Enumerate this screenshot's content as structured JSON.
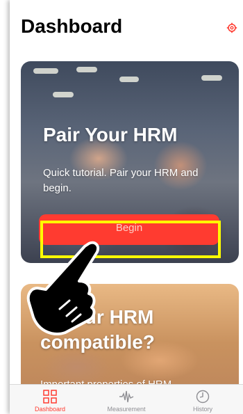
{
  "header": {
    "title": "Dashboard",
    "settings_icon": "settings-gear-icon"
  },
  "cards": [
    {
      "title": "Pair Your HRM",
      "description": "Quick tutorial. Pair your HRM and begin.",
      "button_label": "Begin"
    },
    {
      "title": "Is your HRM compatible?",
      "description": "Important properties of HRM"
    }
  ],
  "tab_bar": {
    "tabs": [
      {
        "label": "Dashboard",
        "icon": "grid-icon",
        "active": true
      },
      {
        "label": "Measurement",
        "icon": "waveform-icon",
        "active": false
      },
      {
        "label": "History",
        "icon": "clock-icon",
        "active": false
      }
    ]
  },
  "colors": {
    "accent": "#ff3b30",
    "highlight": "#ffff00"
  }
}
